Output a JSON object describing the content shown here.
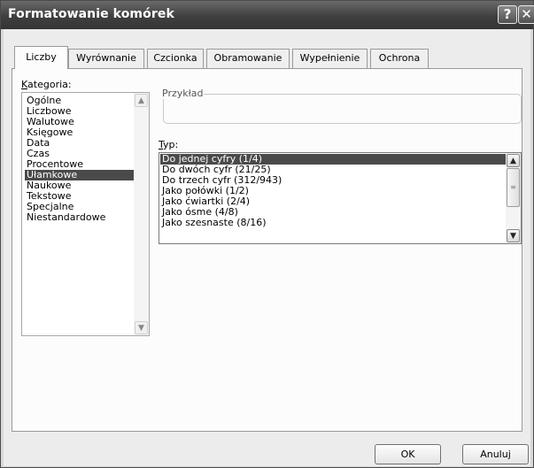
{
  "window": {
    "title": "Formatowanie komórek",
    "help_glyph": "?",
    "close_glyph": "✕"
  },
  "tabs": [
    {
      "label": "Liczby",
      "active": true
    },
    {
      "label": "Wyrównanie",
      "active": false
    },
    {
      "label": "Czcionka",
      "active": false
    },
    {
      "label": "Obramowanie",
      "active": false
    },
    {
      "label": "Wypełnienie",
      "active": false
    },
    {
      "label": "Ochrona",
      "active": false
    }
  ],
  "category": {
    "label_accesskey": "K",
    "label_rest": "ategoria:",
    "items": [
      "Ogólne",
      "Liczbowe",
      "Walutowe",
      "Księgowe",
      "Data",
      "Czas",
      "Procentowe",
      "Ułamkowe",
      "Naukowe",
      "Tekstowe",
      "Specjalne",
      "Niestandardowe"
    ],
    "selected": "Ułamkowe"
  },
  "sample": {
    "label": "Przykład",
    "value": ""
  },
  "type": {
    "label_accesskey": "T",
    "label_rest": "yp:",
    "items": [
      "Do jednej cyfry (1/4)",
      "Do dwóch cyfr (21/25)",
      "Do trzech cyfr (312/943)",
      "Jako połówki (1/2)",
      "Jako ćwiartki (2/4)",
      "Jako ósme (4/8)",
      "Jako szesnaste (8/16)"
    ],
    "selected": "Do jednej cyfry (1/4)"
  },
  "buttons": {
    "ok": "OK",
    "cancel": "Anuluj"
  },
  "icons": {
    "scroll_up": "▲",
    "scroll_down": "▼",
    "thumb_grip": "≡"
  },
  "colors": {
    "title_bar": "#3f3f3f",
    "selection": "#4a4a4a",
    "panel": "#fcfcfc"
  }
}
